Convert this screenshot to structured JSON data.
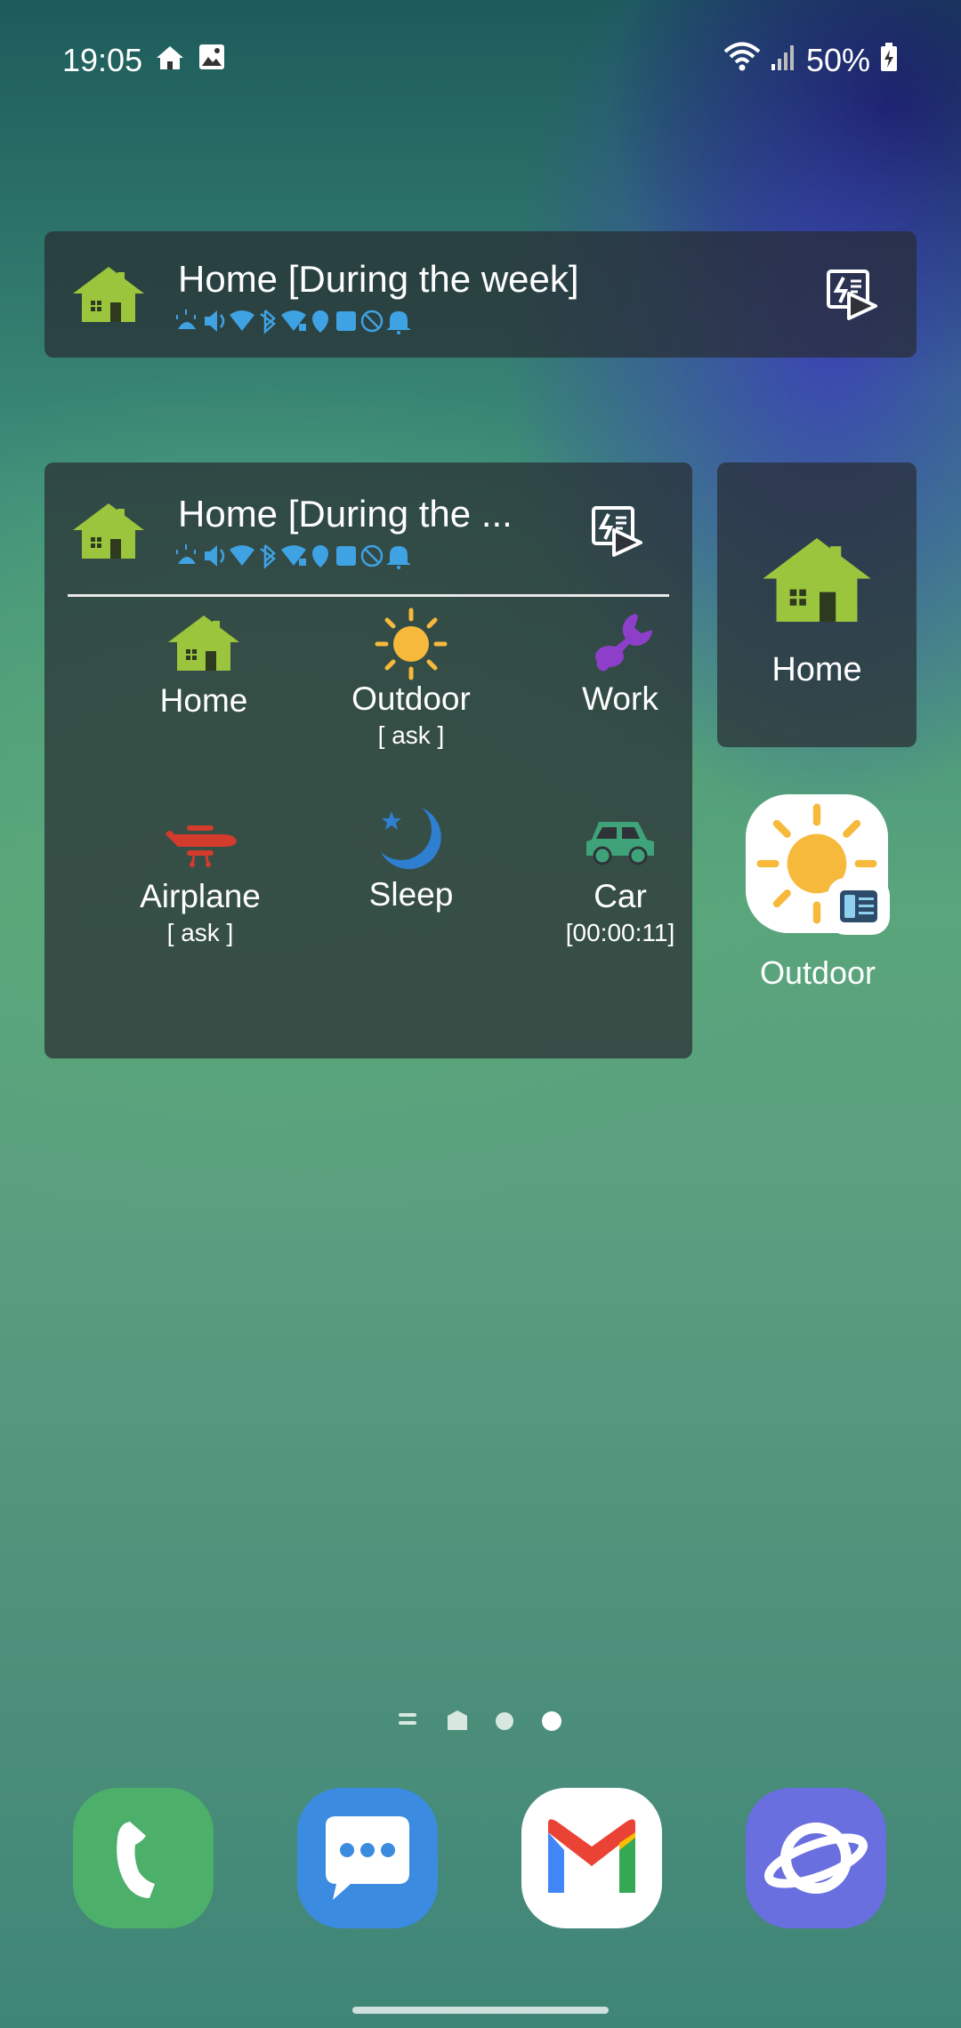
{
  "status_bar": {
    "time": "19:05",
    "battery": "50%"
  },
  "widget_large_title": "Home [During the week]",
  "widget_list": {
    "title": "Home [During the ...",
    "profiles": [
      {
        "label": "Home",
        "sub": ""
      },
      {
        "label": "Outdoor",
        "sub": "[ ask ]"
      },
      {
        "label": "Work",
        "sub": ""
      },
      {
        "label": "Airplane",
        "sub": "[ ask ]"
      },
      {
        "label": "Sleep",
        "sub": ""
      },
      {
        "label": "Car",
        "sub": "[00:00:11]"
      }
    ]
  },
  "widget_home_label": "Home",
  "shortcut_outdoor_label": "Outdoor",
  "colors": {
    "house_green": "#9bc53d",
    "sun_yellow": "#f6b93b",
    "work_purple": "#8e3fc9",
    "airplane_red": "#d33b2c",
    "sleep_blue": "#2f7fd1",
    "car_green": "#3fa37a",
    "status_icon_blue": "#3ea2e3"
  },
  "dock": {
    "apps": [
      "phone-app",
      "messages-app",
      "gmail-app",
      "internet-app"
    ]
  }
}
